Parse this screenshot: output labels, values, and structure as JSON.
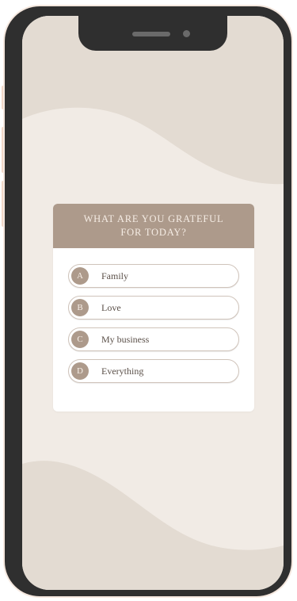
{
  "colors": {
    "accent": "#ad9a8b",
    "screen_background": "#f1ebe5",
    "wave": "#e3dbd2",
    "phone_frame": "#2f2f2f"
  },
  "quiz": {
    "question_line1": "WHAT ARE YOU GRATEFUL",
    "question_line2": "FOR TODAY?",
    "options": [
      {
        "letter": "A",
        "label": "Family"
      },
      {
        "letter": "B",
        "label": "Love"
      },
      {
        "letter": "C",
        "label": "My business"
      },
      {
        "letter": "D",
        "label": "Everything"
      }
    ]
  }
}
